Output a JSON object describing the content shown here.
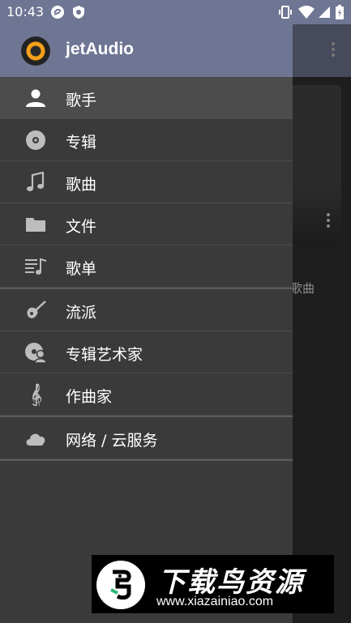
{
  "status_bar": {
    "time": "10:43",
    "icons": [
      "sync-icon",
      "shield-icon",
      "vibrate-icon",
      "wifi-icon",
      "cellular-icon",
      "battery-icon"
    ]
  },
  "app": {
    "title": "jetAudio",
    "accent_color": "#6f7694"
  },
  "menu": {
    "groups": [
      [
        {
          "label": "歌手",
          "icon": "artist-icon",
          "active": true
        },
        {
          "label": "专辑",
          "icon": "album-icon"
        },
        {
          "label": "歌曲",
          "icon": "music-note-icon"
        },
        {
          "label": "文件",
          "icon": "folder-icon"
        },
        {
          "label": "歌单",
          "icon": "playlist-icon"
        }
      ],
      [
        {
          "label": "流派",
          "icon": "guitar-icon"
        },
        {
          "label": "专辑艺术家",
          "icon": "album-artist-icon"
        },
        {
          "label": "作曲家",
          "icon": "treble-clef-icon"
        }
      ],
      [
        {
          "label": "网络 / 云服务",
          "icon": "cloud-icon"
        }
      ]
    ]
  },
  "background": {
    "card_label": "歌曲"
  },
  "watermark": {
    "title": "下载鸟资源",
    "url": "www.xiazainiao.com"
  }
}
